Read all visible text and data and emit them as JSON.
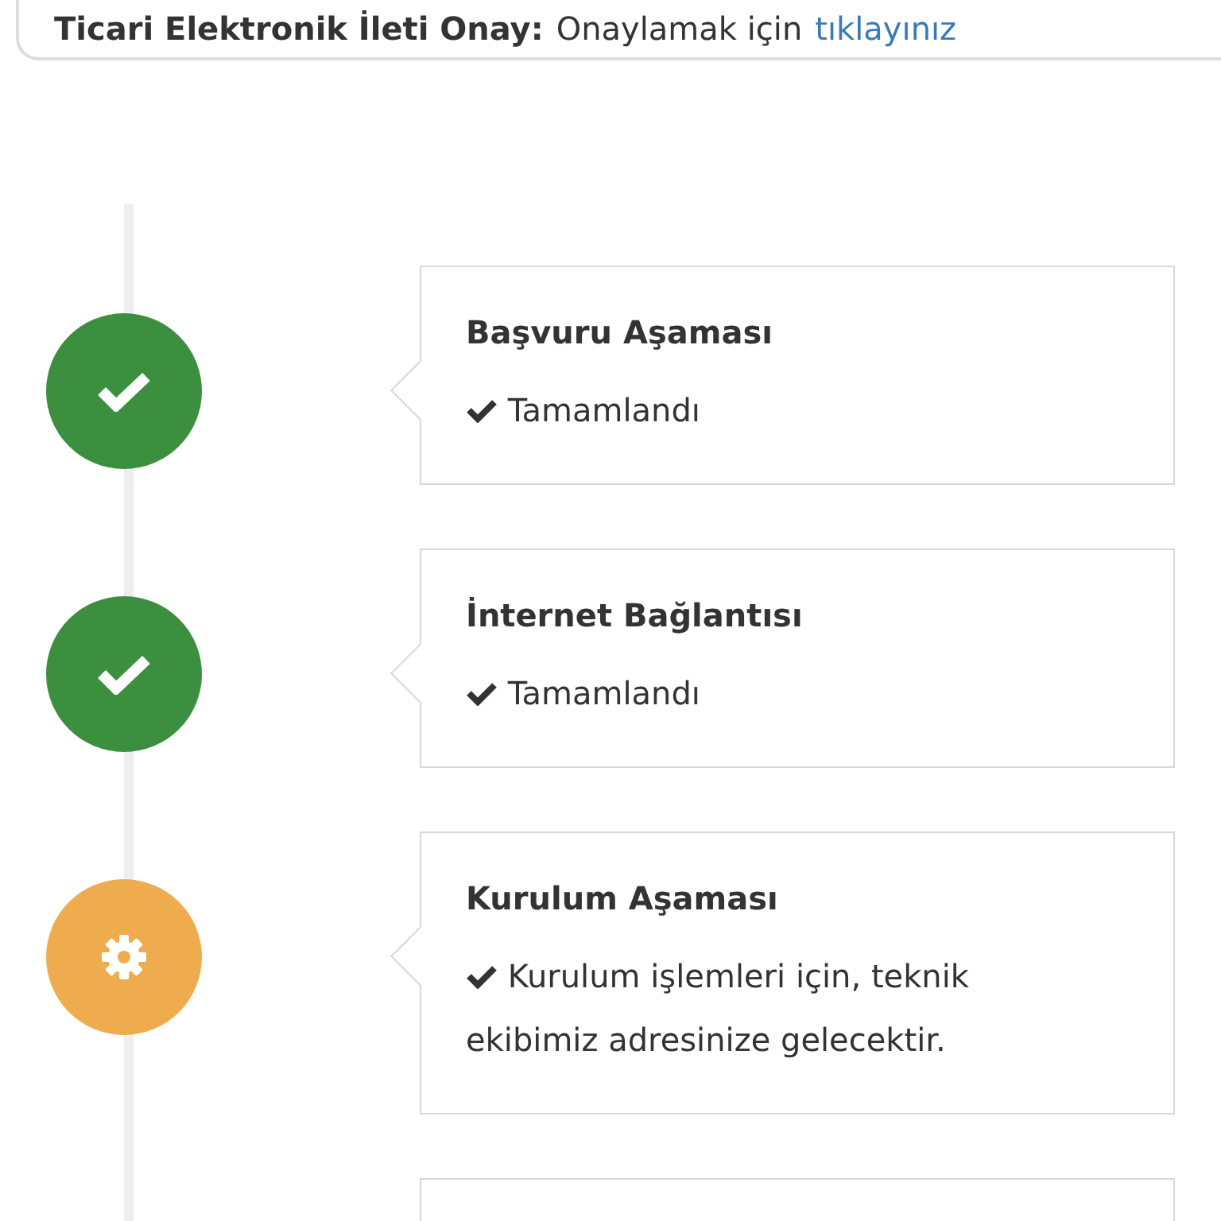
{
  "banner": {
    "label": "Ticari Elektronik İleti Onay:",
    "text": "Onaylamak için",
    "link": "tıklayınız"
  },
  "steps": [
    {
      "kind": "done",
      "title": "Başvuru Aşaması",
      "text": "Tamamlandı"
    },
    {
      "kind": "done",
      "title": "İnternet Bağlantısı",
      "text": "Tamamlandı"
    },
    {
      "kind": "working",
      "title": "Kurulum Aşaması",
      "text": "Kurulum işlemleri için, teknik ekibimiz adresinize gelecektir."
    },
    {
      "kind": "blank"
    }
  ]
}
